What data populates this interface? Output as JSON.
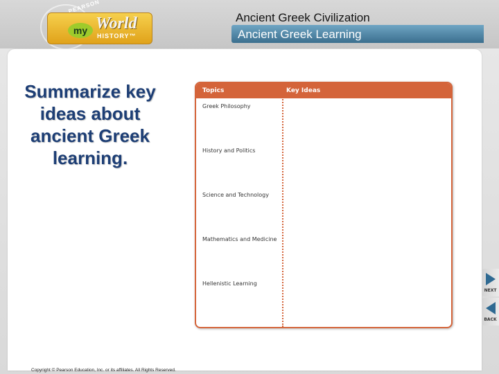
{
  "logo": {
    "publisher": "PEARSON",
    "my": "my",
    "world": "World",
    "history": "HISTORY™"
  },
  "header": {
    "course_title": "Ancient Greek Civilization",
    "lesson_title": "Ancient Greek Learning"
  },
  "prompt": {
    "text": "Summarize key ideas about ancient Greek learning."
  },
  "organizer": {
    "col_topics": "Topics",
    "col_key_ideas": "Key Ideas",
    "topics": [
      "Greek Philosophy",
      "History and Politics",
      "Science and Technology",
      "Mathematics and Medicine",
      "Hellenistic Learning"
    ],
    "accent_color": "#d4643a"
  },
  "nav": {
    "next_label": "NEXT",
    "back_label": "BACK"
  },
  "footer": {
    "copyright": "Copyright © Pearson Education, Inc. or its affiliates. All Rights Reserved."
  }
}
